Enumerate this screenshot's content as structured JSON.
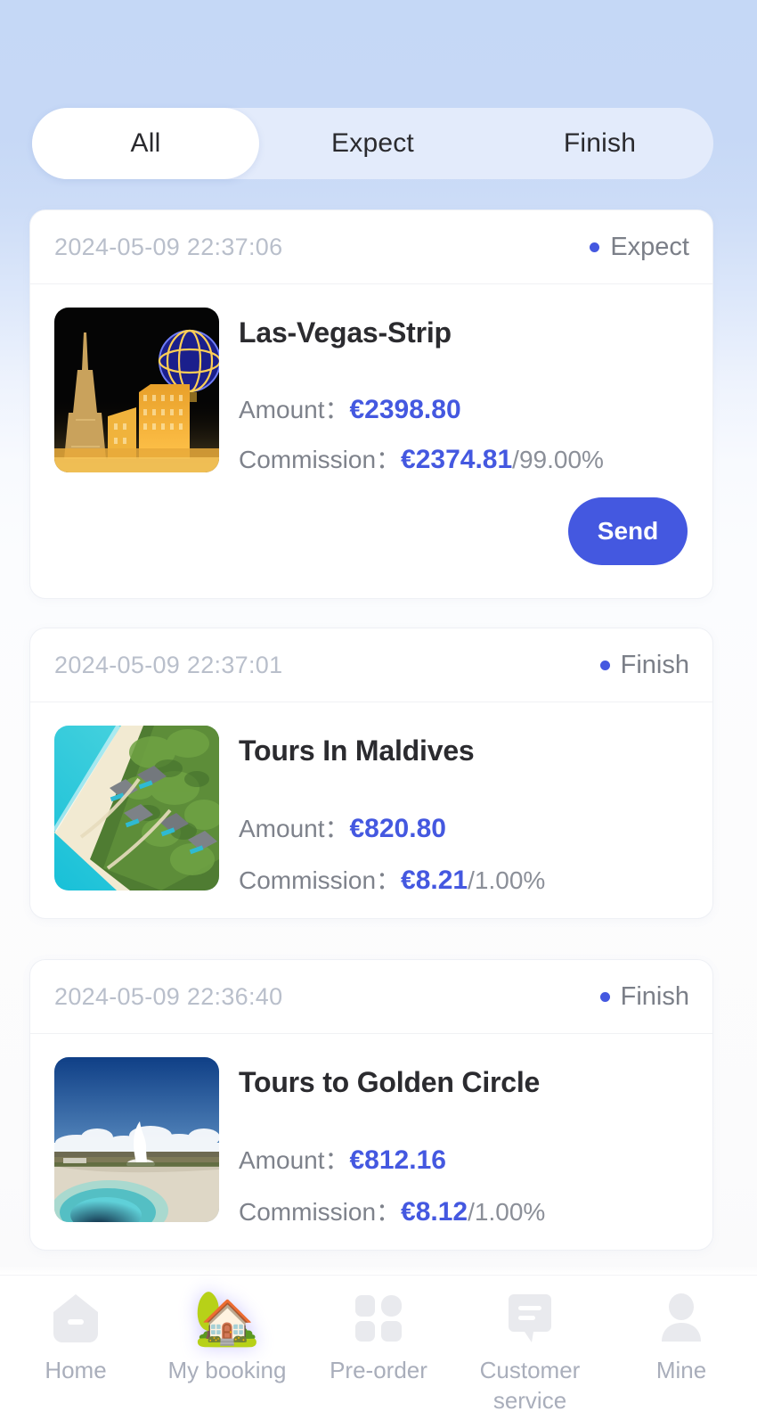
{
  "theme": {
    "accent": "#4458e0",
    "bg_top": "#c5d8f6",
    "bg_bottom": "#ffffff",
    "tab_track": "#e3ebfb",
    "muted_text": "#7e828b",
    "date_text": "#b9bfcb"
  },
  "tabs": [
    {
      "label": "All",
      "active": true
    },
    {
      "label": "Expect",
      "active": false
    },
    {
      "label": "Finish",
      "active": false
    }
  ],
  "labels": {
    "amount": "Amount：",
    "commission": "Commission："
  },
  "orders": [
    {
      "date": "2024-05-09 22:37:06",
      "status": "Expect",
      "title": "Las-Vegas-Strip",
      "thumb": "las-vegas-strip-night-photo",
      "amount": "€2398.80",
      "commission": "€2374.81",
      "commission_rate": "/99.00%",
      "action": "Send",
      "has_action": true
    },
    {
      "date": "2024-05-09 22:37:01",
      "status": "Finish",
      "title": "Tours In Maldives",
      "thumb": "maldives-aerial-beach-photo",
      "amount": "€820.80",
      "commission": "€8.21",
      "commission_rate": "/1.00%",
      "action": "",
      "has_action": false
    },
    {
      "date": "2024-05-09 22:36:40",
      "status": "Finish",
      "title": "Tours to Golden Circle",
      "thumb": "iceland-geyser-golden-circle-photo",
      "amount": "€812.16",
      "commission": "€8.12",
      "commission_rate": "/1.00%",
      "action": "",
      "has_action": false
    }
  ],
  "bottom_nav": [
    {
      "label": "Home",
      "icon": "home-icon",
      "active": false
    },
    {
      "label": "My booking",
      "icon": "house-booking-icon",
      "active": true
    },
    {
      "label": "Pre-order",
      "icon": "grid-squares-icon",
      "active": false
    },
    {
      "label": "Customer service",
      "icon": "chat-bubble-icon",
      "active": false
    },
    {
      "label": "Mine",
      "icon": "person-icon",
      "active": false
    }
  ]
}
